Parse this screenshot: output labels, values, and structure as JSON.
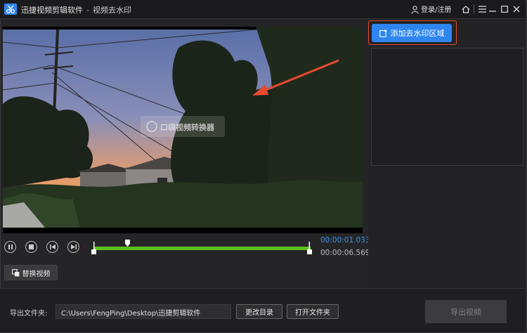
{
  "app": {
    "title": "迅捷视频剪辑软件",
    "separator": "-",
    "subtitle": "视频去水印",
    "login_label": "登录/注册",
    "app_icon": "scissors-logo-icon"
  },
  "window_controls": [
    "home-icon",
    "menu-icon",
    "minimize-icon",
    "maximize-icon",
    "close-icon"
  ],
  "player": {
    "watermark_text": "口袋视频转换器",
    "current_time": "00:00:01.033",
    "total_time": "00:00:06.569",
    "progress": 0.16,
    "controls": [
      "pause-icon",
      "stop-icon",
      "prev-frame-icon",
      "next-frame-icon"
    ]
  },
  "replace_video_label": "替换视频",
  "right_panel": {
    "add_region_label": "添加去水印区域",
    "highlight_color": "#e64a2e"
  },
  "footer": {
    "output_label": "导出文件夹:",
    "output_path": "C:\\Users\\FengPing\\Desktop\\迅捷剪辑软件",
    "change_dir_label": "更改目录",
    "open_folder_label": "打开文件夹",
    "export_label": "导出视频"
  },
  "colors": {
    "accent": "#2f86f0",
    "track": "#5dc21e",
    "time_active": "#3b8fe8"
  }
}
